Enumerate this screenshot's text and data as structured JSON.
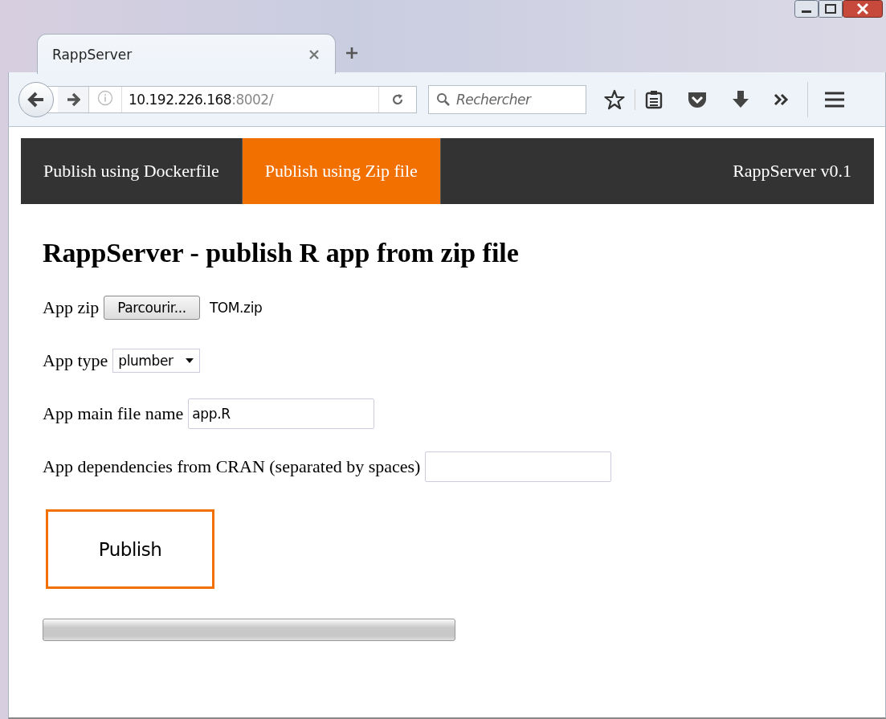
{
  "browser": {
    "tab": {
      "title": "RappServer",
      "selected": true
    },
    "url": {
      "host": "10.192.226.168",
      "port": ":8002/"
    },
    "search": {
      "placeholder": "Rechercher"
    }
  },
  "navbar": {
    "items": [
      {
        "label": "Publish using Dockerfile",
        "selected": false
      },
      {
        "label": "Publish using Zip file",
        "selected": true
      }
    ],
    "brand": "RappServer v0.1"
  },
  "heading": "RappServer - publish R app from zip file",
  "fields": [
    {
      "kind": "file",
      "label": "App zip",
      "button": "Parcourir...",
      "value": "TOM.zip"
    },
    {
      "kind": "select",
      "label": "App type",
      "value": "plumber"
    },
    {
      "kind": "text",
      "label": "App main file name",
      "value": "app.R"
    },
    {
      "kind": "text",
      "label": "App dependencies from CRAN (separated by spaces)"
    }
  ],
  "publish_button": "Publish",
  "progress": {
    "level": 0
  }
}
